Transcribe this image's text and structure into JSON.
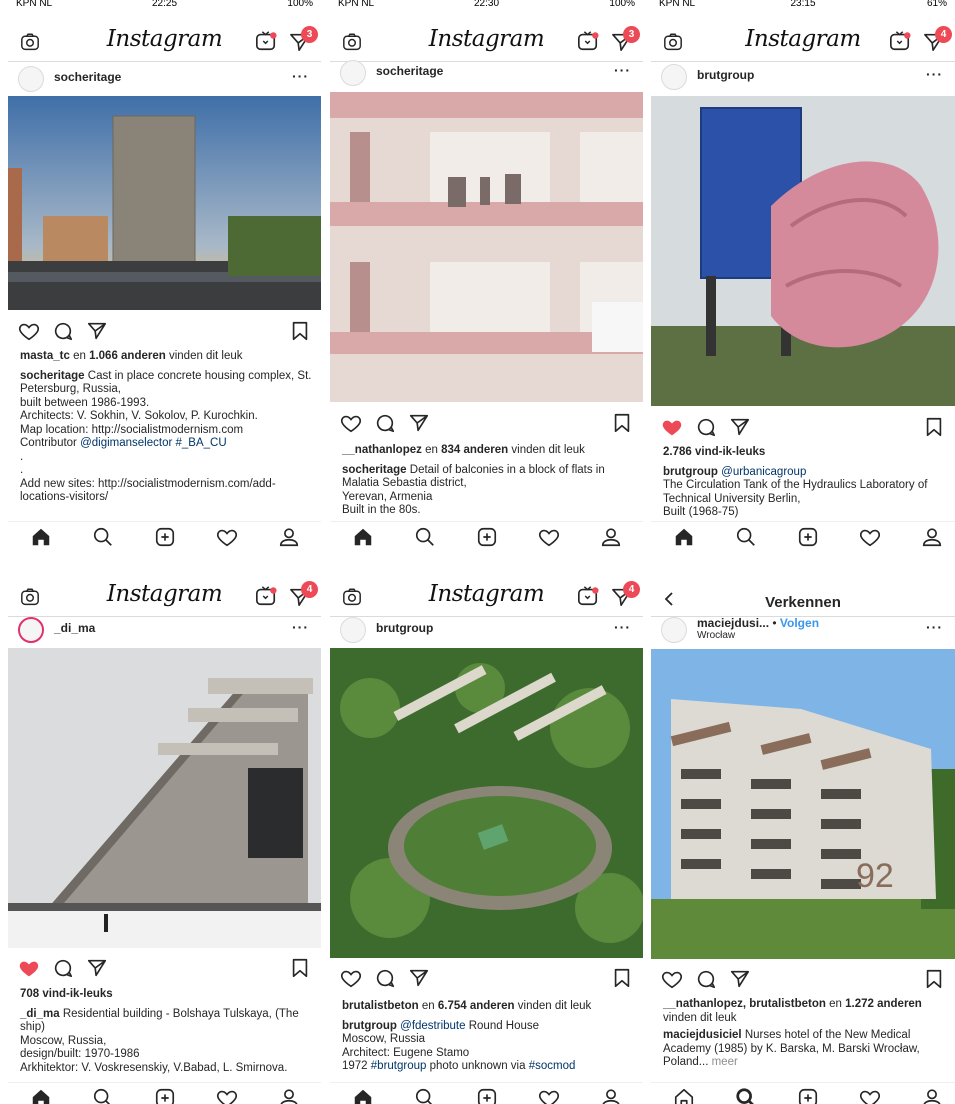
{
  "colors": {
    "like_red": "#ed4956",
    "link_blue": "#003569",
    "follow_blue": "#3897f0"
  },
  "screens": [
    {
      "status": {
        "carrier": "KPN NL",
        "time": "22:25",
        "battery": "100%"
      },
      "header": {
        "logo": "Instagram",
        "badge": "3"
      },
      "post": {
        "username": "socheritage",
        "likes_line": {
          "user": "masta_tc",
          "mid": " en ",
          "count": "1.066 anderen",
          "tail": " vinden dit leuk"
        },
        "caption": [
          "Cast in place concrete housing complex, St. Petersburg, Russia,",
          "built between 1986-1993.",
          "Architects: V. Sokhin, V. Sokolov, P. Kurochkin.",
          "Map location: http://socialistmodernism.com",
          "Contributor ",
          "@digimanselector #_BA_CU",
          ".",
          ".",
          "Add new sites: http://socialistmodernism.com/add-locations-visitors/"
        ]
      }
    },
    {
      "status": {
        "carrier": "KPN NL",
        "time": "22:30",
        "battery": "100%"
      },
      "header": {
        "logo": "Instagram",
        "badge": "3"
      },
      "post": {
        "username": "socheritage",
        "likes_line": {
          "user": "__nathanlopez",
          "mid": " en ",
          "count": "834 anderen",
          "tail": " vinden dit leuk"
        },
        "caption": [
          "Detail of balconies in a block of flats in Malatia Sebastia district,",
          "Yerevan, Armenia",
          "Built in the 80s."
        ]
      }
    },
    {
      "status": {
        "carrier": "KPN NL",
        "time": "23:15",
        "battery": "61%"
      },
      "header": {
        "logo": "Instagram",
        "badge": "4"
      },
      "post": {
        "username": "brutgroup",
        "likes": "2.786 vind-ik-leuks",
        "mention": "@urbanicagroup",
        "caption": [
          "The Circulation Tank of the Hydraulics Laboratory of Technical University Berlin,",
          "Built (1968-75)"
        ]
      }
    },
    {
      "header": {
        "logo": "Instagram",
        "badge": "4"
      },
      "post": {
        "username": "_di_ma",
        "likes": "708 vind-ik-leuks",
        "caption": [
          "Residential building - Bolshaya Tulskaya, (The ship)",
          "Moscow, Russia,",
          "design/built: 1970-1986",
          "Arkhitektor: V. Voskresenskiy, V.Babad, L. Smirnova."
        ]
      }
    },
    {
      "header": {
        "logo": "Instagram",
        "badge": "4"
      },
      "post": {
        "username": "brutgroup",
        "likes_line": {
          "user": "brutalistbeton",
          "mid": " en ",
          "count": "6.754 anderen",
          "tail": " vinden dit leuk"
        },
        "mention": "@fdestribute",
        "caption_head": "Round House",
        "caption": [
          "Moscow, Russia",
          "Architect: Eugene Stamo"
        ],
        "last_line": {
          "tag": "#brutgroup",
          "middle": " photo unknown via ",
          "tag2": "#socmod",
          "year": "1972 "
        }
      }
    },
    {
      "header": {
        "title": "Verkennen"
      },
      "post": {
        "username": "maciejdusi...",
        "sep": " • ",
        "follow": "Volgen",
        "location": "Wrocław",
        "likes_line": {
          "users": "__nathanlopez, brutalistbeton",
          "mid": " en ",
          "count": "1.272 anderen",
          "tail": " vinden dit leuk"
        },
        "caption_user": "maciejdusiciel",
        "caption": "Nurses hotel of the New Medical Academy (1985) by K. Barska, M. Barski Wrocław, Poland...",
        "more": " meer",
        "building_number": "92"
      }
    }
  ]
}
